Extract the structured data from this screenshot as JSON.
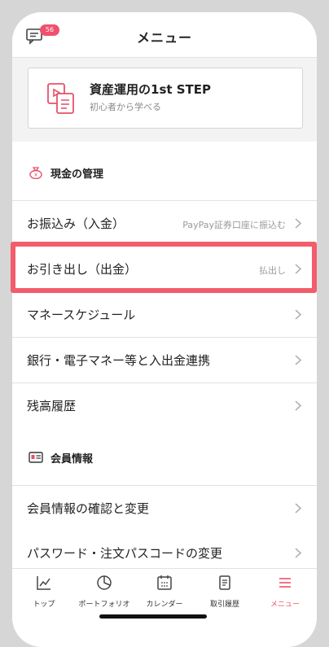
{
  "header": {
    "title": "メニュー",
    "notification_count": "56"
  },
  "banner": {
    "title": "資産運用の1st STEP",
    "subtitle": "初心者から学べる"
  },
  "sections": {
    "cash": {
      "label": "現金の管理",
      "icon": "money-bag-icon"
    },
    "member": {
      "label": "会員情報",
      "icon": "id-card-icon"
    }
  },
  "rows": {
    "deposit": {
      "label": "お振込み（入金）",
      "sub": "PayPay証券口座に振込む"
    },
    "withdraw": {
      "label": "お引き出し（出金）",
      "sub": "払出し"
    },
    "schedule": {
      "label": "マネースケジュール"
    },
    "bank_link": {
      "label": "銀行・電子マネー等と入出金連携"
    },
    "balance_history": {
      "label": "残高履歴"
    },
    "member_info": {
      "label": "会員情報の確認と変更"
    },
    "password": {
      "label": "パスワード・注文パスコードの変更"
    }
  },
  "tabs": [
    {
      "label": "トップ",
      "icon": "chart-icon"
    },
    {
      "label": "ポートフォリオ",
      "icon": "pie-chart-icon"
    },
    {
      "label": "カレンダー",
      "icon": "calendar-icon"
    },
    {
      "label": "取引履歴",
      "icon": "document-icon"
    },
    {
      "label": "メニュー",
      "icon": "menu-icon"
    }
  ],
  "colors": {
    "accent": "#f0506e",
    "highlight": "#f25c6b"
  }
}
